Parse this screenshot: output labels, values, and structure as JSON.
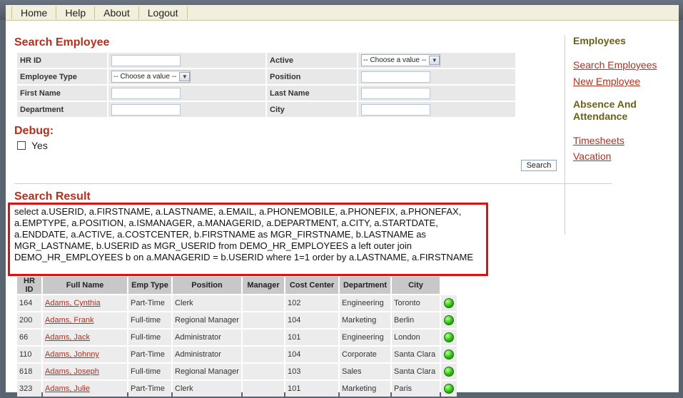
{
  "nav": {
    "items": [
      "Home",
      "Help",
      "About",
      "Logout"
    ]
  },
  "search_form": {
    "title": "Search Employee",
    "labels": {
      "hr_id": "HR ID",
      "active": "Active",
      "employee_type": "Employee Type",
      "position": "Position",
      "first_name": "First Name",
      "last_name": "Last Name",
      "department": "Department",
      "city": "City"
    },
    "active_select": "-- Choose a value --",
    "employee_type_select": "-- Choose a value --"
  },
  "debug": {
    "title": "Debug:",
    "yes_label": "Yes"
  },
  "search_button": "Search",
  "result": {
    "title": "Search Result",
    "sql": "select a.USERID, a.FIRSTNAME, a.LASTNAME, a.EMAIL, a.PHONEMOBILE, a.PHONEFIX, a.PHONEFAX, a.EMPTYPE, a.POSITION, a.ISMANAGER, a.MANAGERID, a.DEPARTMENT, a.CITY, a.STARTDATE, a.ENDDATE, a.ACTIVE, a.COSTCENTER, b.FIRSTNAME as MGR_FIRSTNAME, b.LASTNAME as MGR_LASTNAME, b.USERID as MGR_USERID from DEMO_HR_EMPLOYEES a left outer join DEMO_HR_EMPLOYEES b on a.MANAGERID = b.USERID where 1=1 order by a.LASTNAME, a.FIRSTNAME",
    "columns": [
      "HR ID",
      "Full Name",
      "Emp Type",
      "Position",
      "Manager",
      "Cost Center",
      "Department",
      "City"
    ],
    "rows": [
      {
        "hr_id": "164",
        "name": "Adams, Cynthia",
        "emp_type": "Part-Time",
        "position": "Clerk",
        "manager": "",
        "cost_center": "102",
        "department": "Engineering",
        "city": "Toronto"
      },
      {
        "hr_id": "200",
        "name": "Adams, Frank",
        "emp_type": "Full-time",
        "position": "Regional Manager",
        "manager": "",
        "cost_center": "104",
        "department": "Marketing",
        "city": "Berlin"
      },
      {
        "hr_id": "66",
        "name": "Adams, Jack",
        "emp_type": "Full-time",
        "position": "Administrator",
        "manager": "",
        "cost_center": "101",
        "department": "Engineering",
        "city": "London"
      },
      {
        "hr_id": "110",
        "name": "Adams, Johnny",
        "emp_type": "Part-Time",
        "position": "Administrator",
        "manager": "",
        "cost_center": "104",
        "department": "Corporate",
        "city": "Santa Clara"
      },
      {
        "hr_id": "618",
        "name": "Adams, Joseph",
        "emp_type": "Full-time",
        "position": "Regional Manager",
        "manager": "",
        "cost_center": "103",
        "department": "Sales",
        "city": "Santa Clara"
      },
      {
        "hr_id": "323",
        "name": "Adams, Julie",
        "emp_type": "Part-Time",
        "position": "Clerk",
        "manager": "",
        "cost_center": "101",
        "department": "Marketing",
        "city": "Paris"
      }
    ],
    "status_icon": "green-status-icon"
  },
  "sidebar": {
    "employees_heading": "Employees",
    "search_employees": "Search Employees",
    "new_employee": "New Employee",
    "absence_heading": "Absence And Attendance",
    "timesheets": "Timesheets",
    "vacation": "Vacation"
  },
  "colors": {
    "accent": "#b3301e",
    "sidebar_heading": "#6b6018",
    "highlight_border": "#e01010"
  }
}
